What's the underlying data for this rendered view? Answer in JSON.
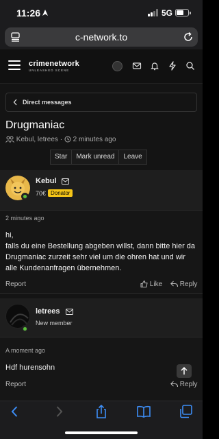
{
  "status_bar": {
    "time": "11:26",
    "network": "5G",
    "battery_level": 0.6
  },
  "browser": {
    "url": "c-network.to"
  },
  "site": {
    "logo_text": "crimenetwork",
    "logo_tagline": "UNLEASHED SCENE"
  },
  "nav": {
    "direct_messages_label": "Direct messages"
  },
  "thread": {
    "title": "Drugmaniac",
    "participants": "Kebul, letrees",
    "time_ago": "2 minutes ago",
    "actions": [
      "Star",
      "Mark unread",
      "Leave"
    ]
  },
  "messages": [
    {
      "author": "Kebul",
      "currency": "70€",
      "badge": "Donator",
      "time": "2 minutes ago",
      "lines": [
        "hi,",
        "falls du eine Bestellung abgeben willst, dann bitte hier da Drugmaniac zurzeit sehr viel um die ohren hat und wir alle Kundenanfragen übernehmen."
      ],
      "report": "Report",
      "like": "Like",
      "reply": "Reply"
    },
    {
      "author": "letrees",
      "role": "New member",
      "time": "A moment ago",
      "lines": [
        "Hdf hurensohn"
      ],
      "report": "Report",
      "reply": "Reply"
    }
  ],
  "icons": {
    "location": "location-arrow-icon",
    "menu": "hamburger-menu-icon",
    "mail": "envelope-icon",
    "bell": "bell-icon",
    "bolt": "lightning-icon",
    "search": "search-icon",
    "scroll_top": "arrow-up-icon"
  }
}
